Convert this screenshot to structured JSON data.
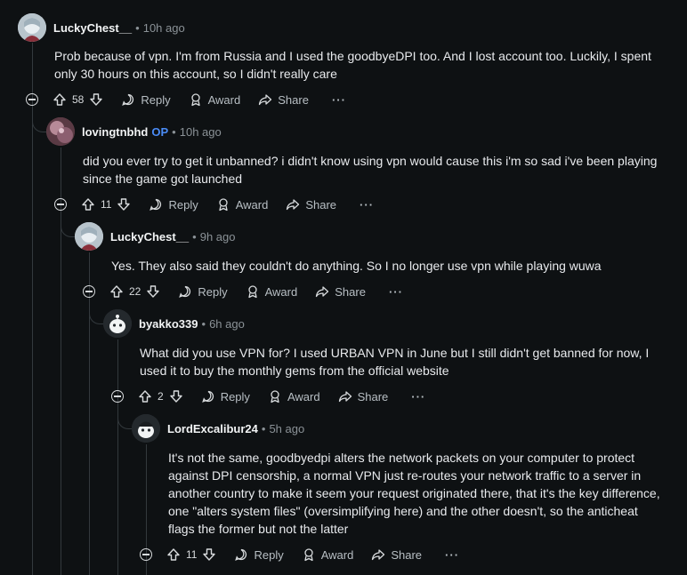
{
  "comments": [
    {
      "author": "LuckyChest__",
      "op": "",
      "time": "10h ago",
      "body": "Prob because of vpn. I'm from Russia and I used the goodbyeDPI too. And I lost account too. Luckily, I spent only 30 hours on this account, so I didn't really care",
      "score": "58"
    },
    {
      "author": "lovingtnbhd",
      "op": "OP",
      "time": "10h ago",
      "body": "did you ever try to get it unbanned? i didn't know using vpn would cause this i'm so sad i've been playing since the game got launched",
      "score": "11"
    },
    {
      "author": "LuckyChest__",
      "op": "",
      "time": "9h ago",
      "body": "Yes. They also said they couldn't do anything. So I no longer use vpn while playing wuwa",
      "score": "22"
    },
    {
      "author": "byakko339",
      "op": "",
      "time": "6h ago",
      "body": "What did you use VPN for? I used URBAN VPN in June but I still didn't get banned for now, I used it to buy the monthly gems from the official website",
      "score": "2"
    },
    {
      "author": "LordExcalibur24",
      "op": "",
      "time": "5h ago",
      "body": "It's not the same, goodbyedpi alters the network packets on your computer to protect against DPI censorship, a normal VPN just re-routes your network traffic to a server in another country to make it seem your request originated there, that it's the key difference, one \"alters system files\" (oversimplifying here) and the other doesn't, so the anticheat flags the former but not the latter",
      "score": "11"
    }
  ],
  "labels": {
    "reply": "Reply",
    "award": "Award",
    "share": "Share",
    "more": "···",
    "separator": "•"
  },
  "colors": {
    "background": "#0e1113",
    "op_tag": "#4a8bf5",
    "thread_line": "#33393d"
  }
}
